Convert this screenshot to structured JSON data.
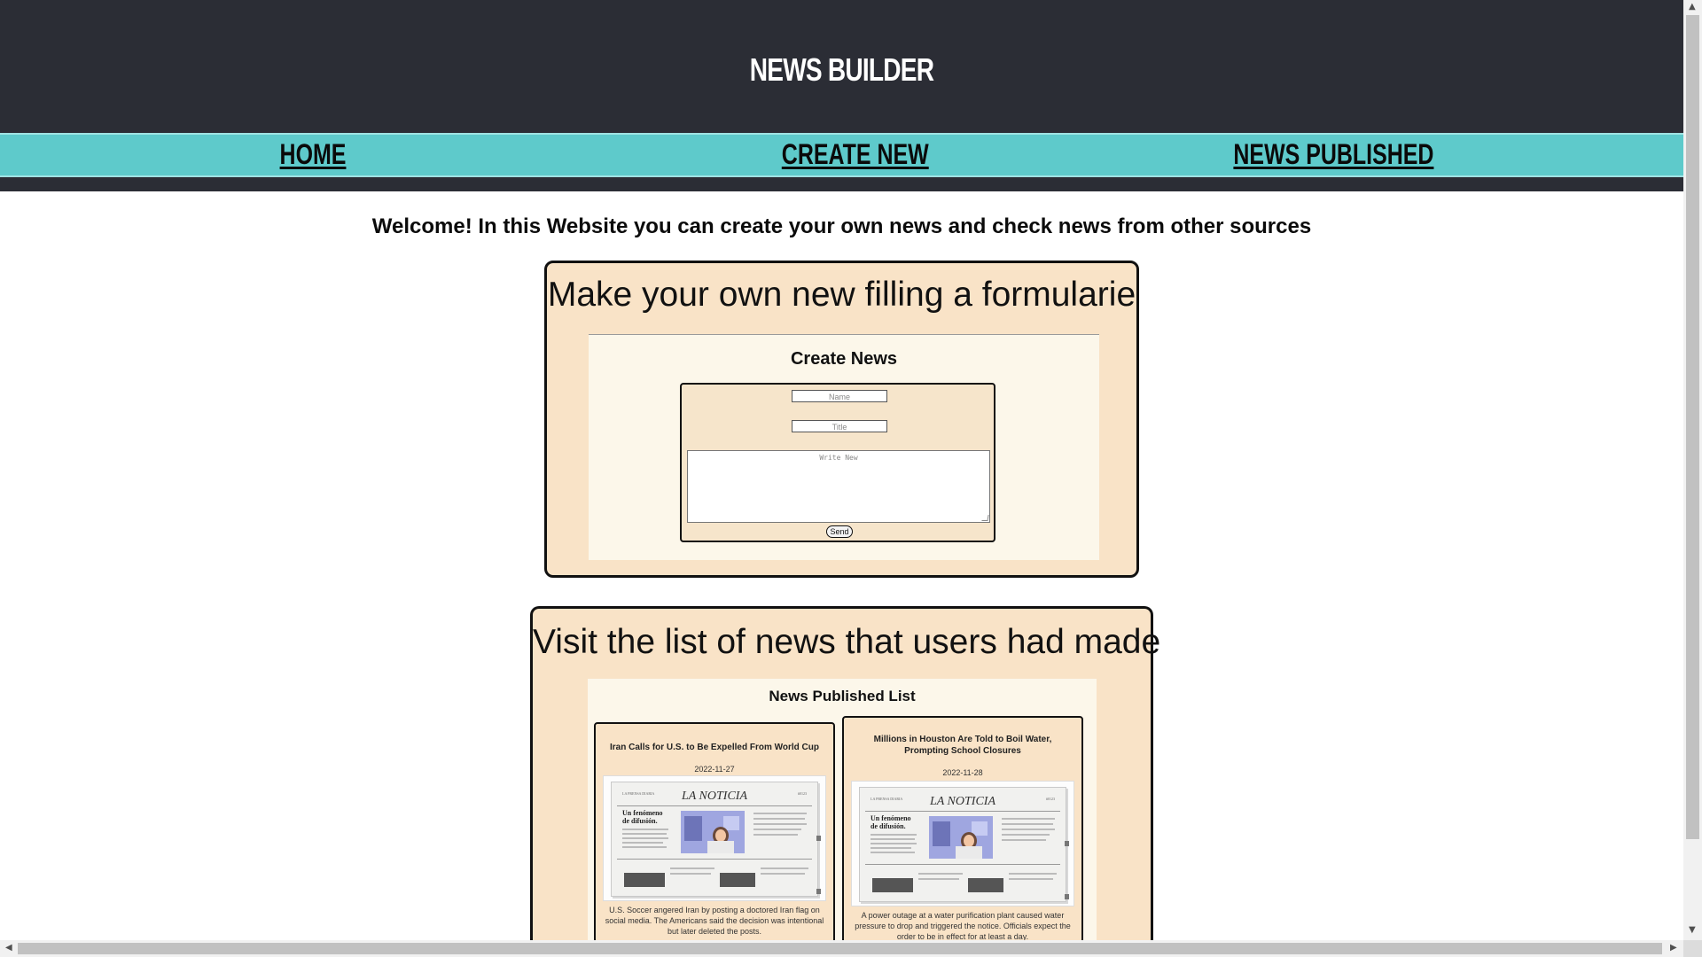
{
  "header": {
    "logo": "NEWS BUILDER",
    "nav": {
      "home": "HOME",
      "create_new": "CREATE NEW",
      "news_published": "NEWS PUBLISHED"
    }
  },
  "welcome": "Welcome! In this Website you can create your own news and check news from other sources",
  "create_section": {
    "title": "Make your own new filling a formularie",
    "form_title": "Create News",
    "name_placeholder": "Name",
    "title_placeholder": "Title",
    "body_placeholder": "Write New",
    "send_label": "Send"
  },
  "list_section": {
    "title": "Visit the list of news that users had made",
    "list_title": "News Published List",
    "news": [
      {
        "title": "Iran Calls for U.S. to Be Expelled From World Cup",
        "date": "2022-11-27",
        "description": "U.S. Soccer angered Iran by posting a doctored Iran flag on social media. The Americans said the decision was intentional but later deleted the posts.",
        "image": {
          "masthead": "LA NOTICIA",
          "small_left": "LA PRENSA DIARIA",
          "small_right": "#0123",
          "headline": "Un fenómeno de difusión."
        }
      },
      {
        "title": "Millions in Houston Are Told to Boil Water, Prompting School Closures",
        "date": "2022-11-28",
        "description": "A power outage at a water purification plant caused water pressure to drop and triggered the notice. Officials expect the order to be in effect for at least a day.",
        "image": {
          "masthead": "LA NOTICIA",
          "small_left": "LA PRENSA DIARIA",
          "small_right": "#0123",
          "headline": "Un fenómeno de difusión."
        }
      }
    ]
  },
  "colors": {
    "header_bg": "#2b2d35",
    "nav_bg": "#5ecacb",
    "card_bg": "#f9e3c7",
    "inner_bg": "#fcf7ea"
  },
  "icons": {
    "scroll_up": "triangle-up",
    "scroll_down": "triangle-down",
    "scroll_left": "triangle-left",
    "scroll_right": "triangle-right"
  }
}
